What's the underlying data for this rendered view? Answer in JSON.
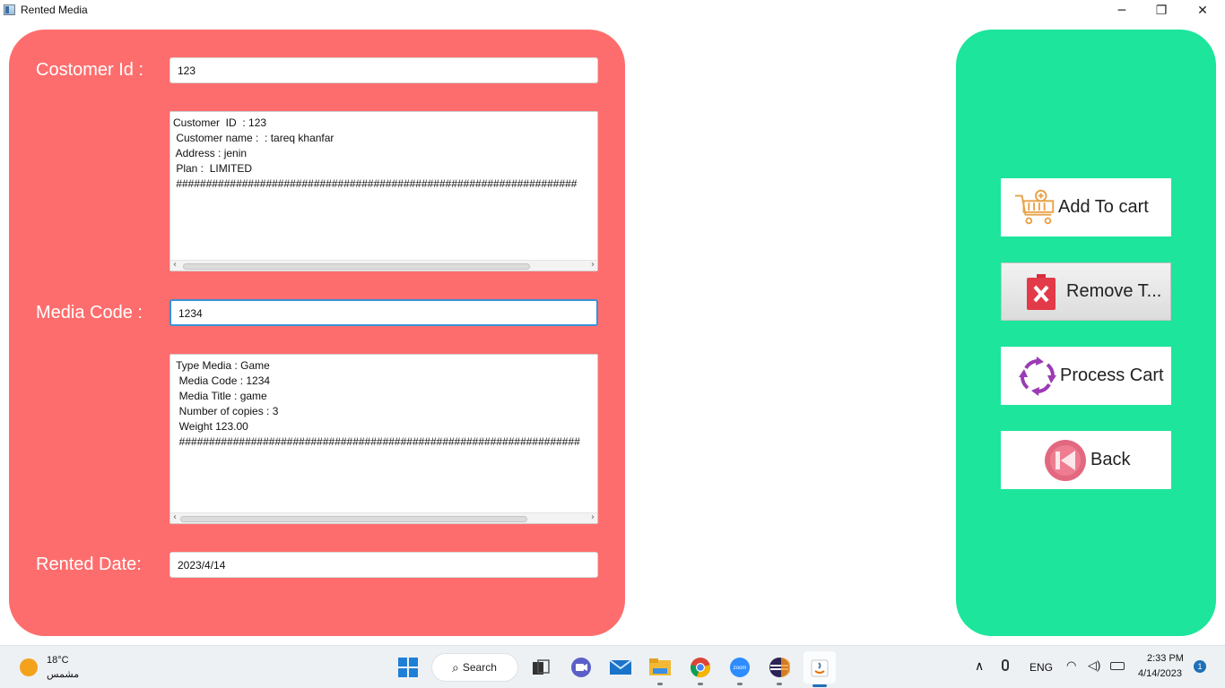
{
  "window": {
    "title": "Rented Media",
    "minimize_glyph": "─",
    "restore_glyph": "❐",
    "close_glyph": "✕"
  },
  "form": {
    "customer_id_label": "Costomer Id :",
    "customer_id_value": "123",
    "customer_info": "Customer  ID  : 123\n Customer name :  : tareq khanfar\n Address : jenin\n Plan :  LIMITED\n ###################################################################",
    "media_code_label": "Media Code :",
    "media_code_value": "1234",
    "media_info": " Type Media : Game\n  Media Code : 1234\n  Media Title : game\n  Number of copies : 3\n  Weight 123.00\n  ###################################################################",
    "rented_date_label": "Rented Date:",
    "rented_date_value": "2023/4/14"
  },
  "actions": {
    "add_to_cart": "Add To cart",
    "remove": "Remove T...",
    "process_cart": "Process Cart",
    "back": "Back"
  },
  "taskbar": {
    "weather_temp": "18°C",
    "weather_desc": "مشمس",
    "search_label": "Search",
    "language": "ENG",
    "time": "2:33 PM",
    "date": "4/14/2023",
    "notification_count": "1"
  },
  "icons": {
    "app": "window-app-icon",
    "cart": "cart-add-icon",
    "remove": "remove-x-icon",
    "process": "process-cycle-icon",
    "back": "back-icon"
  },
  "colors": {
    "left_panel": "#fe6d6d",
    "right_panel": "#1de59c",
    "focus_border": "#3a90d8"
  }
}
